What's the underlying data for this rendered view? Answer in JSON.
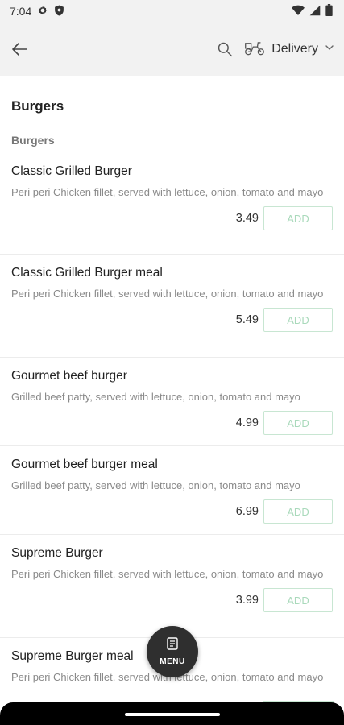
{
  "status_bar": {
    "time": "7:04"
  },
  "header": {
    "delivery_label": "Delivery"
  },
  "section": {
    "title": "Burgers",
    "subtitle": "Burgers"
  },
  "items": [
    {
      "name": "Classic Grilled Burger",
      "description": "Peri peri Chicken fillet, served with lettuce, onion, tomato and mayo",
      "price": "3.49",
      "add_label": "ADD"
    },
    {
      "name": "Classic Grilled Burger meal",
      "description": "Peri peri Chicken fillet, served with lettuce, onion, tomato and mayo",
      "price": "5.49",
      "add_label": "ADD"
    },
    {
      "name": "Gourmet beef burger",
      "description": "Grilled beef patty, served with lettuce, onion, tomato and mayo",
      "price": "4.99",
      "add_label": "ADD"
    },
    {
      "name": "Gourmet beef burger meal",
      "description": "Grilled beef patty, served with lettuce, onion, tomato and mayo",
      "price": "6.99",
      "add_label": "ADD"
    },
    {
      "name": "Supreme Burger",
      "description": "Peri peri Chicken fillet, served with lettuce, onion, tomato and mayo",
      "price": "3.99",
      "add_label": "ADD"
    },
    {
      "name": "Supreme Burger meal",
      "description": "Peri peri Chicken fillet, served with lettuce, onion, tomato and mayo"
    }
  ],
  "fab": {
    "label": "MENU"
  },
  "colors": {
    "accent_border": "#c8e6d2",
    "accent_text": "#a9d9bb",
    "fab_bg": "#2f2f2f"
  }
}
